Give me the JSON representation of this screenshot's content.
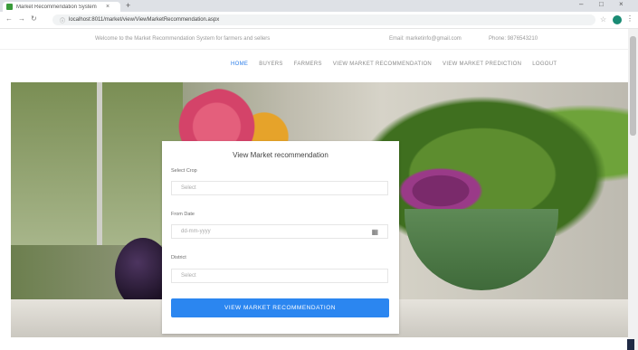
{
  "browser": {
    "tab_title": "Market Recommendation System",
    "new_tab": "+",
    "url": "localhost:8011/market/view/ViewMarketRecommendation.aspx"
  },
  "infobar": {
    "left_text": "Welcome to the Market Recommendation System for farmers and sellers",
    "email": "Email: marketinfo@gmail.com",
    "phone": "Phone: 9876543210"
  },
  "nav": {
    "items": [
      "HOME",
      "BUYERS",
      "FARMERS",
      "VIEW MARKET RECOMMENDATION",
      "VIEW MARKET PREDICTION",
      "LOGOUT"
    ]
  },
  "form": {
    "title": "View Market recommendation",
    "select_crop_label": "Select Crop",
    "select_crop_value": "Select",
    "date_label": "From Date",
    "date_placeholder": "dd-mm-yyyy",
    "district_label": "District",
    "district_value": "Select",
    "submit_label": "VIEW MARKET RECOMMENDATION"
  }
}
